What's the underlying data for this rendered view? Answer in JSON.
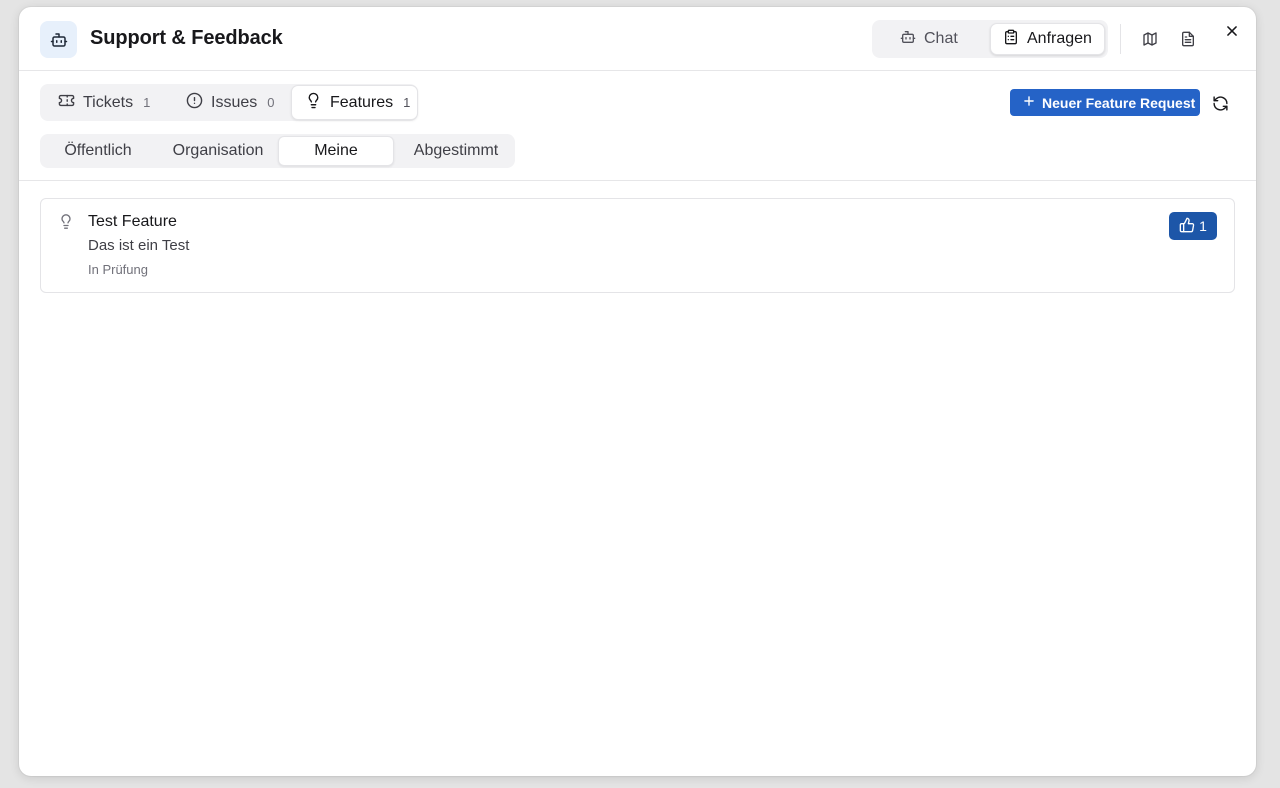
{
  "header": {
    "title": "Support & Feedback",
    "app_icon": "robot-icon",
    "modes": [
      {
        "label": "Chat",
        "icon": "robot-icon"
      },
      {
        "label": "Anfragen",
        "icon": "clipboard-icon",
        "active": true
      }
    ],
    "actions": [
      {
        "icon": "map-icon"
      },
      {
        "icon": "document-icon"
      },
      {
        "icon": "close-icon"
      }
    ]
  },
  "tabs": [
    {
      "label": "Tickets",
      "count": "1",
      "icon": "ticket-icon"
    },
    {
      "label": "Issues",
      "count": "0",
      "icon": "alert-circle-icon"
    },
    {
      "label": "Features",
      "count": "1",
      "icon": "lightbulb-icon",
      "active": true
    }
  ],
  "toolbar": {
    "new_request_label": "Neuer Feature Request",
    "new_request_icon": "plus-icon",
    "refresh_icon": "refresh-icon"
  },
  "filters": [
    {
      "label": "Öffentlich"
    },
    {
      "label": "Organisation"
    },
    {
      "label": "Meine",
      "active": true
    },
    {
      "label": "Abgestimmt"
    }
  ],
  "features": [
    {
      "title": "Test Feature",
      "description": "Das ist ein Test",
      "status": "In Prüfung",
      "votes": "1",
      "icon": "lightbulb-icon"
    }
  ],
  "colors": {
    "accent": "#2563c7",
    "vote_button": "#1d56a8",
    "app_icon_bg": "#e7f0fb"
  }
}
